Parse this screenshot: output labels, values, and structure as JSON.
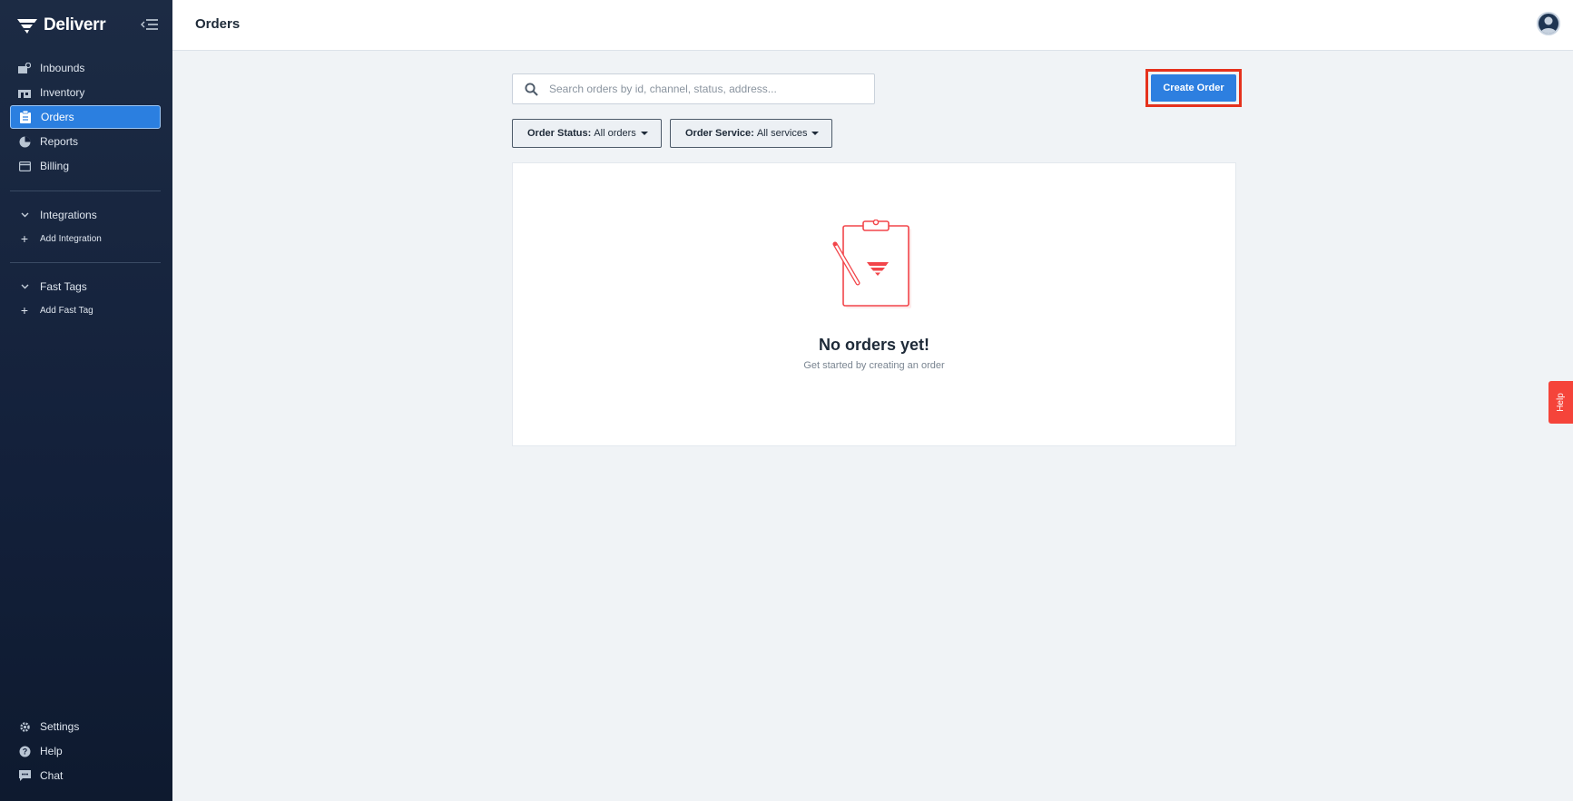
{
  "brand": {
    "name": "Deliverr"
  },
  "sidebar": {
    "items": [
      {
        "label": "Inbounds",
        "icon": "inbounds-icon"
      },
      {
        "label": "Inventory",
        "icon": "inventory-icon"
      },
      {
        "label": "Orders",
        "icon": "orders-icon",
        "active": true
      },
      {
        "label": "Reports",
        "icon": "reports-icon"
      },
      {
        "label": "Billing",
        "icon": "billing-icon"
      }
    ],
    "integrations": {
      "label": "Integrations",
      "add_label": "Add Integration"
    },
    "fast_tags": {
      "label": "Fast Tags",
      "add_label": "Add Fast Tag"
    },
    "bottom": [
      {
        "label": "Settings",
        "icon": "gear-icon"
      },
      {
        "label": "Help",
        "icon": "help-circle-icon"
      },
      {
        "label": "Chat",
        "icon": "chat-icon"
      }
    ]
  },
  "header": {
    "title": "Orders"
  },
  "search": {
    "placeholder": "Search orders by id, channel, status, address..."
  },
  "toolbar": {
    "create_label": "Create Order"
  },
  "filters": {
    "status": {
      "label": "Order Status:",
      "value": "All orders"
    },
    "service": {
      "label": "Order Service:",
      "value": "All services"
    }
  },
  "empty_state": {
    "title": "No orders yet!",
    "subtitle": "Get started by creating an order"
  },
  "help_tab": {
    "label": "Help"
  },
  "colors": {
    "accent": "#2d7fe0",
    "sidebar_bg": "#13203a",
    "highlight": "#e5321d",
    "help_tab": "#f5443a"
  }
}
